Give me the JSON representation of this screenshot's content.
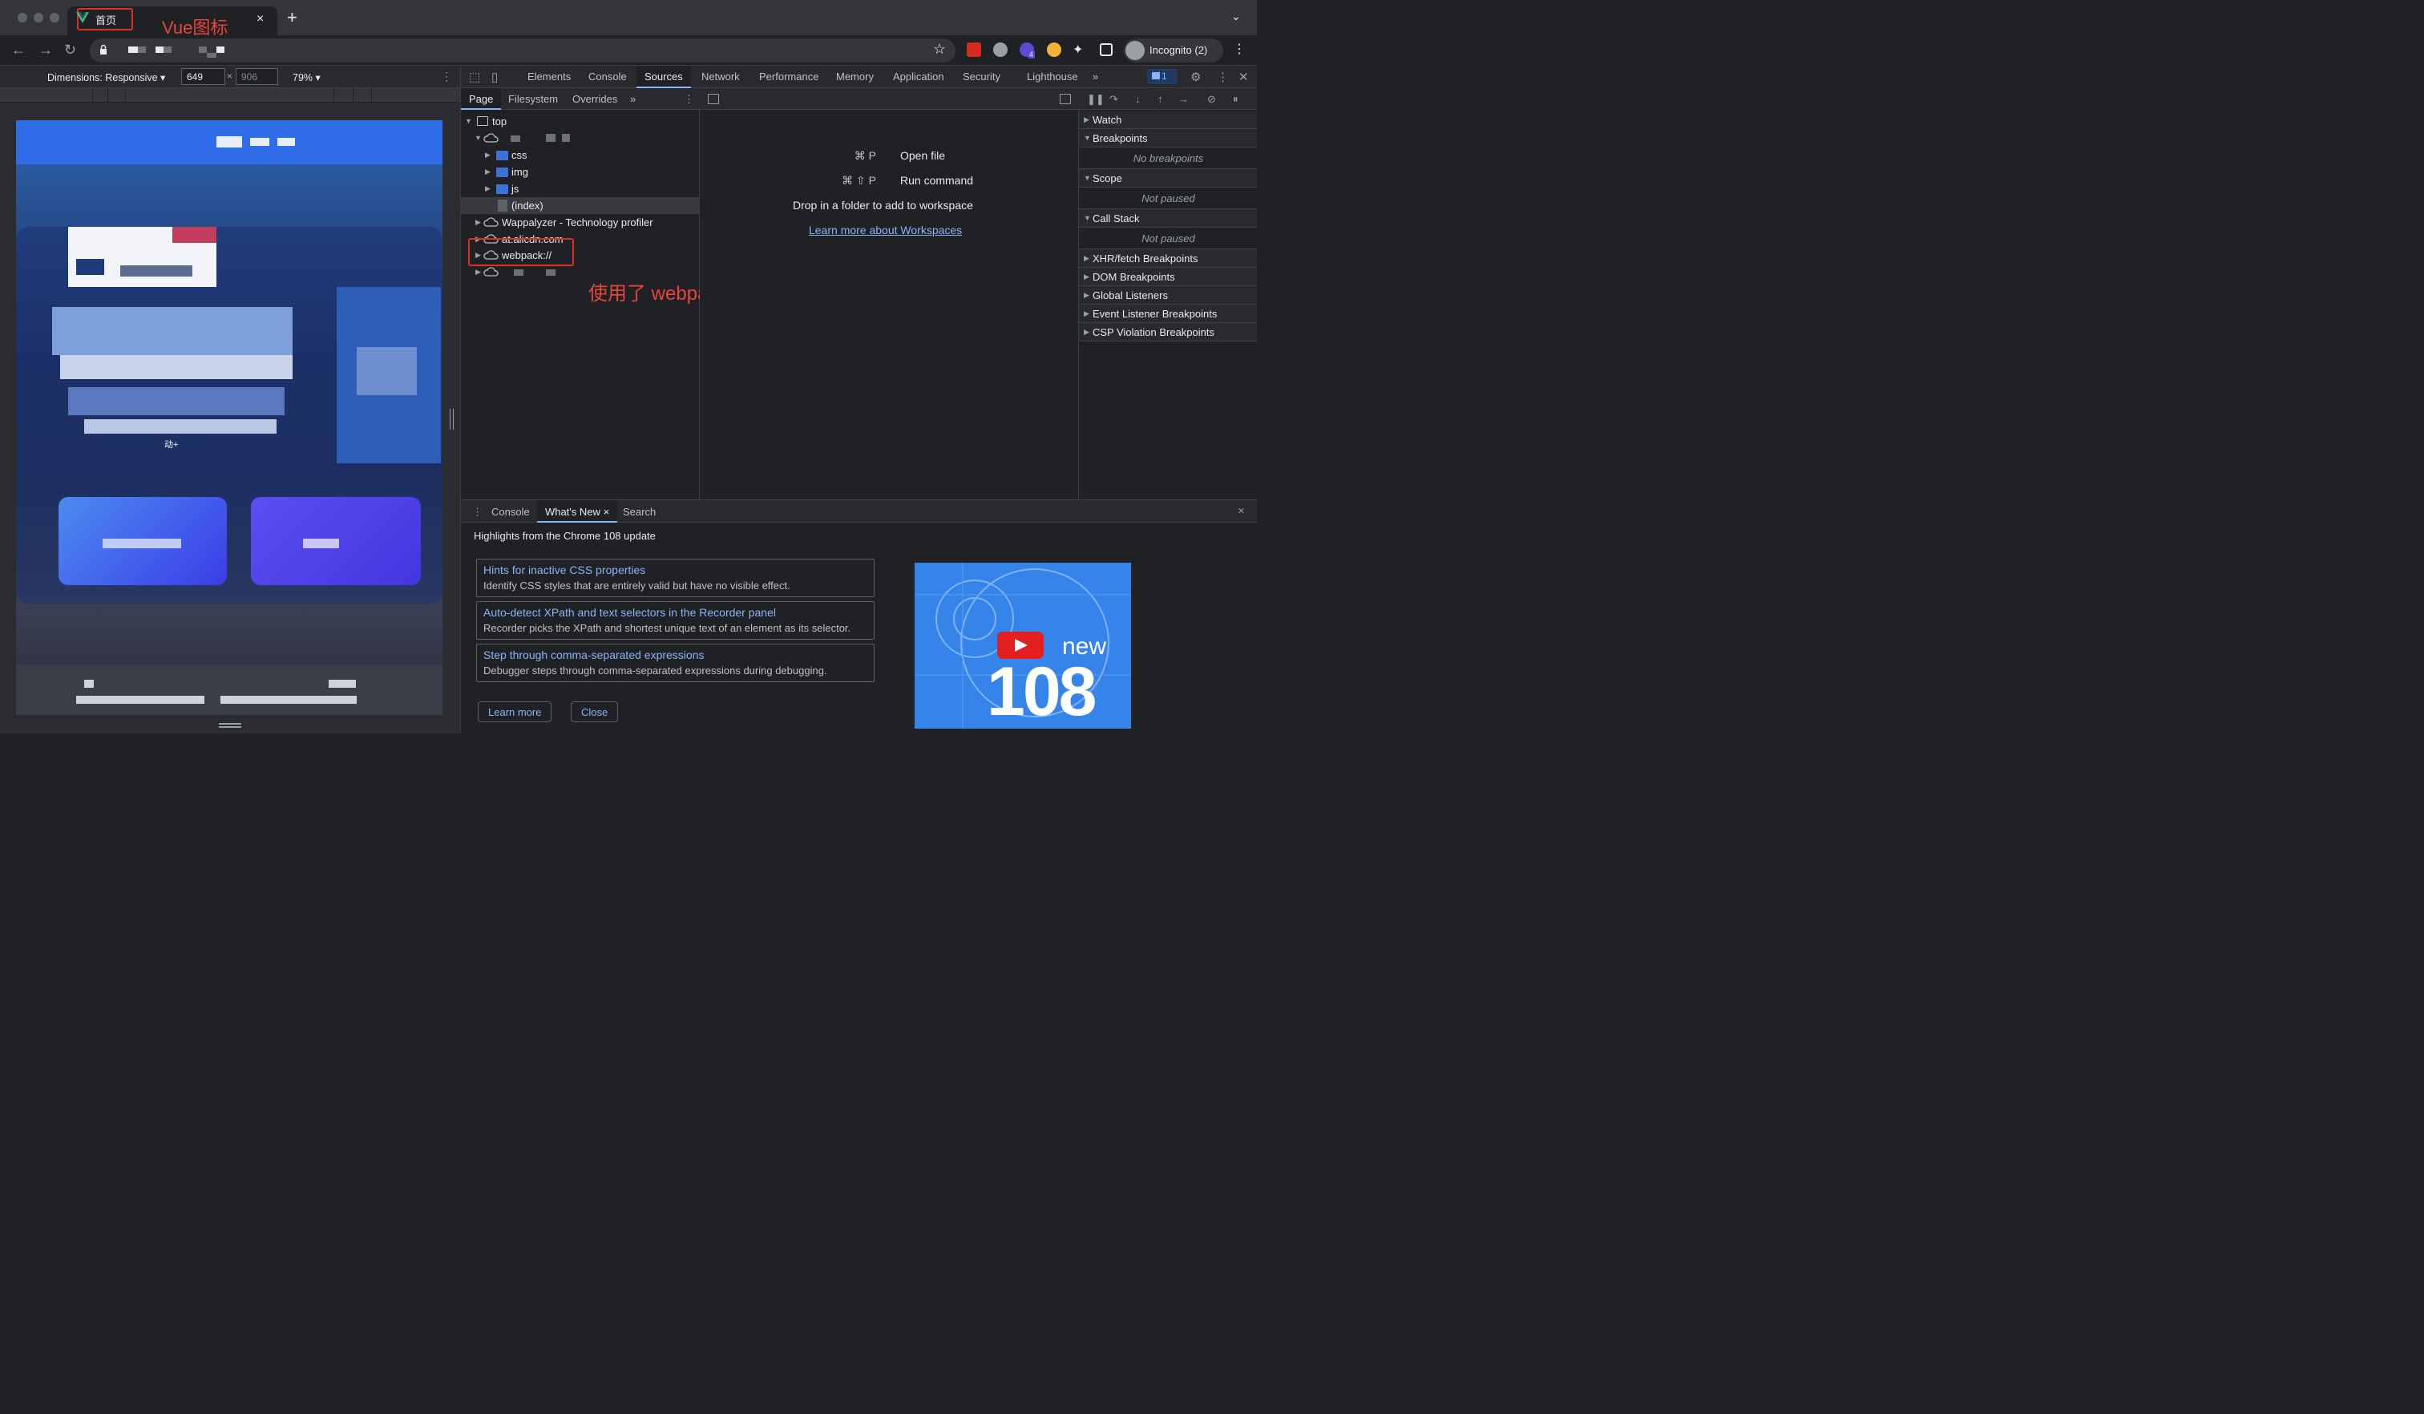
{
  "browser": {
    "tab": {
      "title": "首页",
      "close": "×"
    },
    "annotation_tab": "Vue图标",
    "new_tab": "+",
    "tab_dropdown": "⌄",
    "incognito_label": "Incognito (2)",
    "extension_badge": "4",
    "icons": [
      "back-icon",
      "forward-icon",
      "reload-icon",
      "lock-icon",
      "star-icon",
      "extensions-icon",
      "side-panel-icon",
      "menu-icon"
    ]
  },
  "device_toolbar": {
    "dimensions_label": "Dimensions: Responsive ▾",
    "width": "649",
    "times": "×",
    "height_placeholder": "906",
    "zoom": "79% ▾"
  },
  "viewport_page": {
    "button_text_1": "动+"
  },
  "devtools": {
    "tabs": [
      "Elements",
      "Console",
      "Sources",
      "Network",
      "Performance",
      "Memory",
      "Application",
      "Security",
      "Lighthouse"
    ],
    "selected_tab": "Sources",
    "more_tabs": "»",
    "issues_count": "1",
    "navigator": {
      "tabs": [
        "Page",
        "Filesystem",
        "Overrides"
      ],
      "more": "»",
      "tree": [
        {
          "label": "top"
        },
        {
          "label": "css"
        },
        {
          "label": "img"
        },
        {
          "label": "js"
        },
        {
          "label": "(index)"
        },
        {
          "label": "Wappalyzer - Technology profiler"
        },
        {
          "label": "at.alicdn.com"
        },
        {
          "label": "webpack://"
        }
      ],
      "annotation_webpack": "使用了 webpack 打包"
    },
    "editor": {
      "open_file_key": "⌘ P",
      "open_file": "Open file",
      "run_command_key": "⌘ ⇧ P",
      "run_command": "Run command",
      "drop_folder": "Drop in a folder to add to workspace",
      "learn_more": "Learn more about Workspaces"
    },
    "debugger": {
      "panes": [
        {
          "title": "Watch",
          "expanded": false
        },
        {
          "title": "Breakpoints",
          "expanded": true,
          "body": "No breakpoints"
        },
        {
          "title": "Scope",
          "expanded": true,
          "body": "Not paused"
        },
        {
          "title": "Call Stack",
          "expanded": true,
          "body": "Not paused"
        },
        {
          "title": "XHR/fetch Breakpoints",
          "expanded": false
        },
        {
          "title": "DOM Breakpoints",
          "expanded": false
        },
        {
          "title": "Global Listeners",
          "expanded": false
        },
        {
          "title": "Event Listener Breakpoints",
          "expanded": false
        },
        {
          "title": "CSP Violation Breakpoints",
          "expanded": false
        }
      ]
    },
    "drawer": {
      "tabs": [
        "Console",
        "What's New",
        "Search"
      ],
      "selected_tab": "What's New",
      "tab_close": "×",
      "close": "×",
      "heading": "Highlights from the Chrome 108 update",
      "items": [
        {
          "title": "Hints for inactive CSS properties",
          "desc": "Identify CSS styles that are entirely valid but have no visible effect."
        },
        {
          "title": "Auto-detect XPath and text selectors in the Recorder panel",
          "desc": "Recorder picks the XPath and shortest unique text of an element as its selector."
        },
        {
          "title": "Step through comma-separated expressions",
          "desc": "Debugger steps through comma-separated expressions during debugging."
        }
      ],
      "learn_more": "Learn more",
      "close_button": "Close",
      "thumb_new": "new",
      "thumb_version": "108"
    }
  },
  "colors": {
    "accent": "#8ab4f8",
    "annotation": "#e8453c",
    "tab_bg": "#35363a",
    "panel_bg": "#202124"
  }
}
